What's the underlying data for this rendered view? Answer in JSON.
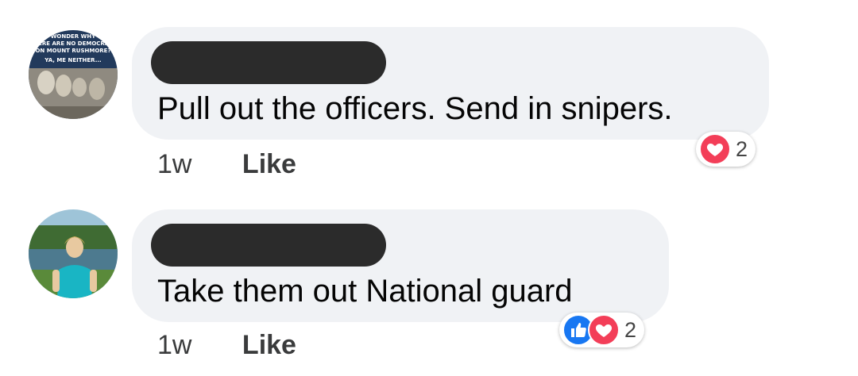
{
  "comments": [
    {
      "avatar": "mount-rushmore-meme-avatar",
      "avatar_text": "WONDER WHY THERE ARE NO DEMOCRATS ON MOUNT RUSHMORE? YA, ME NEITHER...",
      "text": "Pull out the officers. Send in snipers.",
      "timestamp": "1w",
      "like_label": "Like",
      "reactions": [
        "love"
      ],
      "reaction_count": "2"
    },
    {
      "avatar": "woman-outdoors-avatar",
      "text": "Take them out National guard",
      "timestamp": "1w",
      "like_label": "Like",
      "reactions": [
        "like",
        "love"
      ],
      "reaction_count": "2"
    }
  ],
  "colors": {
    "bubble": "#f0f2f5",
    "love": "#f33e58",
    "like": "#1877f2",
    "redaction": "#2b2b2b"
  }
}
